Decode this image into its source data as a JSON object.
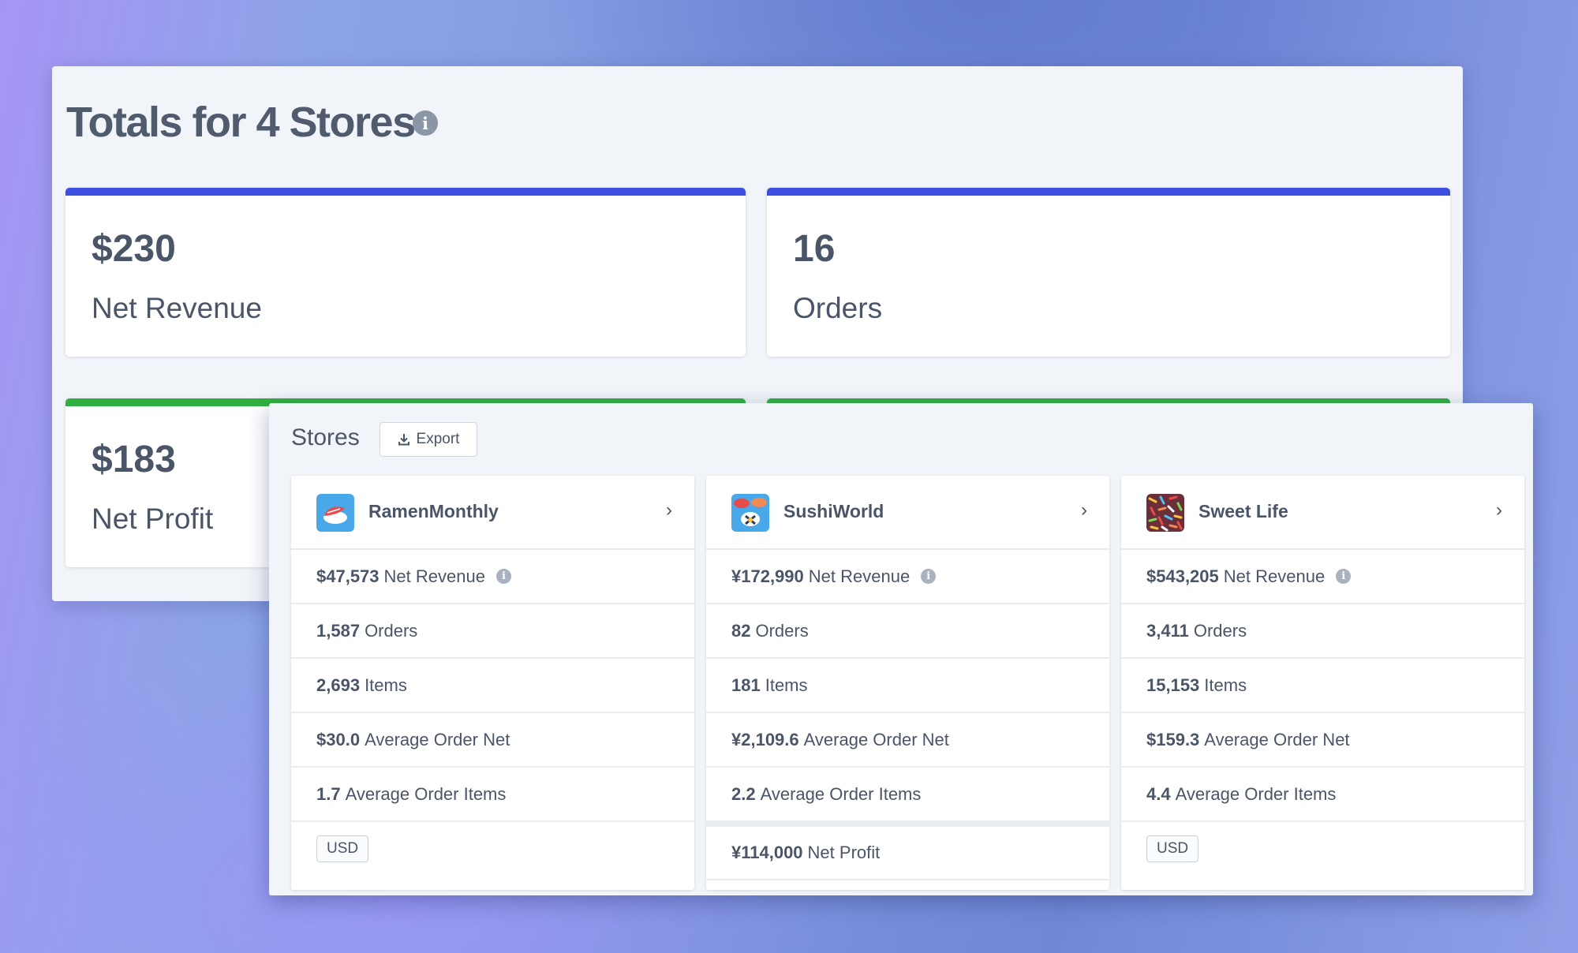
{
  "totals": {
    "title": "Totals for 4 Stores",
    "info_icon": "info-icon",
    "cards": [
      {
        "value": "$230",
        "label": "Net Revenue",
        "accent": "#3d4fe0"
      },
      {
        "value": "16",
        "label": "Orders",
        "accent": "#3d4fe0"
      },
      {
        "value": "$183",
        "label": "Net Profit",
        "accent": "#31b041"
      },
      {
        "value": "",
        "label": "",
        "accent": "#31b041"
      }
    ]
  },
  "stores": {
    "title": "Stores",
    "export_label": "Export",
    "export_icon": "download-icon",
    "items": [
      {
        "name": "RamenMonthly",
        "logo_icon": "sushi-logo-icon",
        "net_revenue_value": "$47,573",
        "net_revenue_label": "Net Revenue",
        "orders_value": "1,587",
        "orders_label": "Orders",
        "items_value": "2,693",
        "items_label": "Items",
        "avg_net_value": "$30.0",
        "avg_net_label": "Average Order Net",
        "avg_items_value": "1.7",
        "avg_items_label": "Average Order Items",
        "currency": "USD"
      },
      {
        "name": "SushiWorld",
        "logo_icon": "sushi-world-logo-icon",
        "net_revenue_value": "¥172,990",
        "net_revenue_label": "Net Revenue",
        "orders_value": "82",
        "orders_label": "Orders",
        "items_value": "181",
        "items_label": "Items",
        "avg_net_value": "¥2,109.6",
        "avg_net_label": "Average Order Net",
        "avg_items_value": "2.2",
        "avg_items_label": "Average Order Items",
        "net_profit_value": "¥114,000",
        "net_profit_label": "Net Profit"
      },
      {
        "name": "Sweet Life",
        "logo_icon": "sprinkles-logo-icon",
        "net_revenue_value": "$543,205",
        "net_revenue_label": "Net Revenue",
        "orders_value": "3,411",
        "orders_label": "Orders",
        "items_value": "15,153",
        "items_label": "Items",
        "avg_net_value": "$159.3",
        "avg_net_label": "Average Order Net",
        "avg_items_value": "4.4",
        "avg_items_label": "Average Order Items",
        "currency": "USD"
      }
    ]
  },
  "colors": {
    "blue_accent": "#3d4fe0",
    "green_accent": "#31b041",
    "text": "#4a5568",
    "panel": "#f1f4f8"
  }
}
